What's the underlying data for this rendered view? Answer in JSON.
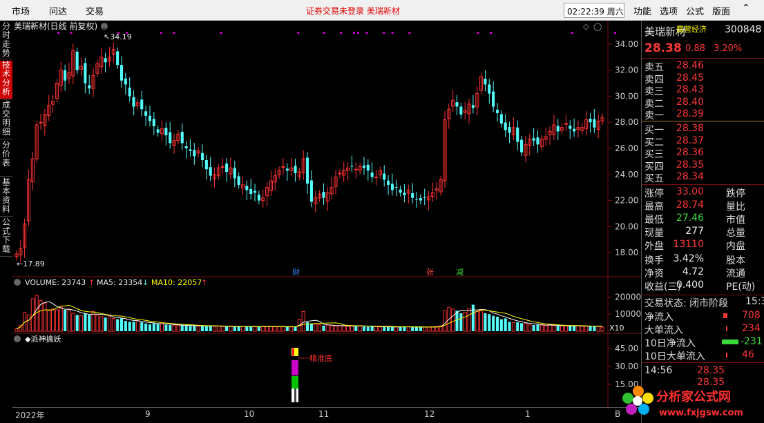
{
  "topbar": {
    "menu": [
      "市场",
      "问达",
      "交易"
    ],
    "notice": "证券交易未登录  美瑞新材",
    "clock": "02:22:39 周六",
    "right_menu": [
      "功能",
      "选项",
      "公式",
      "版面"
    ]
  },
  "left_tabs": [
    "分时走势",
    "技术分析",
    "成交明细",
    "分价表",
    "基本资料",
    "公式下载"
  ],
  "chart": {
    "title": "美瑞新材(日线 前复权)",
    "high_label": "34.19",
    "low_label": "17.89",
    "price_ticks": [
      "34.00",
      "32.00",
      "30.00",
      "28.00",
      "26.00",
      "24.00",
      "22.00",
      "20.00",
      "18.00"
    ],
    "markers": [
      "财",
      "张",
      "减"
    ],
    "volume_title": "VOLUME: 23743",
    "ma5": "MA5: 23354",
    "ma10": "MA10: 22057",
    "vol_ticks": [
      "20000",
      "10000"
    ],
    "vol_unit": "X10",
    "indicator_title": "◆派神擒妖",
    "indicator_label": "精准底",
    "ind_ticks": [
      "45.00",
      "30.00",
      "15.00"
    ],
    "x_labels": [
      "2022年",
      "9",
      "10",
      "11",
      "12",
      "1"
    ],
    "last_x": "B"
  },
  "chart_data": {
    "type": "candlestick",
    "closes": [
      17.9,
      18.3,
      20.2,
      23.6,
      25.2,
      27.8,
      28.0,
      28.6,
      29.3,
      29.6,
      31.0,
      32.0,
      31.2,
      31.8,
      33.5,
      32.0,
      32.3,
      31.0,
      30.6,
      31.6,
      32.5,
      33.0,
      32.6,
      33.0,
      33.6,
      32.4,
      31.2,
      30.9,
      30.0,
      29.2,
      29.5,
      29.0,
      28.5,
      28.1,
      27.7,
      27.2,
      27.5,
      27.0,
      26.4,
      26.6,
      27.1,
      26.4,
      26.0,
      25.8,
      25.4,
      25.8,
      25.1,
      24.4,
      23.9,
      24.0,
      24.5,
      24.6,
      24.2,
      24.5,
      23.7,
      23.2,
      23.2,
      22.8,
      22.5,
      22.6,
      22.0,
      22.2,
      23.0,
      23.5,
      23.9,
      24.3,
      24.6,
      24.3,
      24.5,
      24.1,
      24.2,
      25.2,
      23.3,
      21.9,
      22.2,
      22.5,
      22.2,
      22.6,
      23.0,
      23.8,
      24.1,
      24.3,
      24.5,
      24.6,
      24.4,
      24.6,
      24.5,
      24.3,
      23.8,
      23.8,
      24.3,
      23.6,
      23.2,
      22.8,
      23.0,
      22.6,
      22.4,
      22.8,
      22.2,
      22.1,
      22.0,
      22.2,
      22.3,
      22.6,
      22.9,
      23.6,
      28.2,
      29.0,
      29.7,
      29.2,
      28.6,
      28.9,
      29.4,
      29.1,
      30.2,
      31.5,
      30.9,
      30.2,
      29.2,
      28.7,
      27.9,
      27.4,
      27.2,
      27.6,
      26.5,
      25.7,
      26.3,
      26.7,
      26.6,
      26.3,
      26.7,
      26.9,
      27.3,
      27.8,
      27.3,
      27.6,
      27.9,
      27.5,
      27.3,
      27.6,
      27.6,
      28.2,
      28.0,
      27.6,
      28.1,
      28.38
    ],
    "price_range": [
      17.0,
      35.0
    ],
    "volume_range": [
      0,
      25000
    ],
    "volumes": [
      1500,
      3500,
      11000,
      9500,
      19000,
      21000,
      18000,
      16500,
      12000,
      13000,
      12500,
      14000,
      12500,
      12500,
      10500,
      9500,
      9000,
      10500,
      9500,
      11500,
      9500,
      8500,
      8000,
      8500,
      7500,
      7000,
      7500,
      6000,
      5500,
      5500,
      6200,
      5200,
      4500,
      4000,
      4600,
      4200,
      4500,
      3800,
      3600,
      3500,
      3300,
      3600,
      3400,
      3100,
      3200,
      3000,
      3200,
      2800,
      3100,
      2900,
      3000,
      2800,
      2700,
      2800,
      2600,
      3000,
      2800,
      2700,
      2800,
      2600,
      2600,
      2800,
      2900,
      2700,
      2600,
      2700,
      2800,
      2600,
      2500,
      2600,
      7000,
      11500,
      5200,
      4200,
      4000,
      3800,
      3300,
      3600,
      3200,
      3000,
      3400,
      3100,
      2900,
      3000,
      3200,
      3300,
      2700,
      2600,
      2900,
      2700,
      2500,
      2400,
      2700,
      2600,
      2500,
      2400,
      2700,
      2600,
      2300,
      2500,
      2400,
      2400,
      2500,
      2600,
      2800,
      3100,
      12000,
      14000,
      13000,
      12000,
      10500,
      11000,
      13500,
      15500,
      11500,
      12000,
      10500,
      10000,
      9000,
      8500,
      7000,
      7500,
      5500,
      5000,
      5200,
      4700,
      4500,
      3700,
      3600,
      3800,
      3500,
      3300,
      4000,
      3200,
      3200,
      3000,
      3100,
      3000,
      3100,
      3300,
      2900,
      2900,
      3000,
      2800,
      2900,
      2400
    ],
    "overlay_markers": [
      {
        "label": "财",
        "x_index": 72
      },
      {
        "label": "张",
        "x_index": 106
      },
      {
        "label": "减",
        "x_index": 111
      }
    ]
  },
  "panel": {
    "name": "美瑞新材",
    "badge": "露营经济",
    "code": "300848",
    "price": "28.38",
    "change": "0.88",
    "pct": "3.20%",
    "asks": [
      [
        "卖五",
        "28.46"
      ],
      [
        "卖四",
        "28.45"
      ],
      [
        "卖三",
        "28.43"
      ],
      [
        "卖二",
        "28.40"
      ],
      [
        "卖一",
        "28.39"
      ]
    ],
    "bids": [
      [
        "买一",
        "28.38"
      ],
      [
        "买二",
        "28.37"
      ],
      [
        "买三",
        "28.36"
      ],
      [
        "买四",
        "28.35"
      ],
      [
        "买五",
        "28.34"
      ]
    ],
    "stats": [
      [
        "涨停",
        "33.00",
        "跌停"
      ],
      [
        "最高",
        "28.74",
        "量比"
      ],
      [
        "最低",
        "27.46",
        "市值"
      ],
      [
        "现量",
        "277",
        "总量"
      ],
      [
        "外盘",
        "13110",
        "内盘"
      ],
      [
        "换手",
        "3.42%",
        "股本"
      ],
      [
        "净资",
        "4.72",
        "流通"
      ],
      [
        "收益(三)",
        "0.400",
        "PE(动)"
      ]
    ],
    "trade_status": "交易状态: 闭市阶段",
    "trade_time": "15:3",
    "flows": [
      [
        "净流入",
        "708"
      ],
      [
        "大单流入",
        "234"
      ],
      [
        "10日净流入",
        "-231"
      ],
      [
        "10日大单流入",
        "46"
      ]
    ],
    "tick_time": "14:56",
    "tick_price": "28.35",
    "tick_price2": "28.35"
  },
  "colors": {
    "up": "#ff3232",
    "down": "#54fcfc",
    "ma5": "#ffffff",
    "ma10": "#ffff00",
    "indicator_mark": "#c800c8"
  },
  "logo": {
    "text": "分析家公式网",
    "url": "www.fxjgsw.com"
  }
}
